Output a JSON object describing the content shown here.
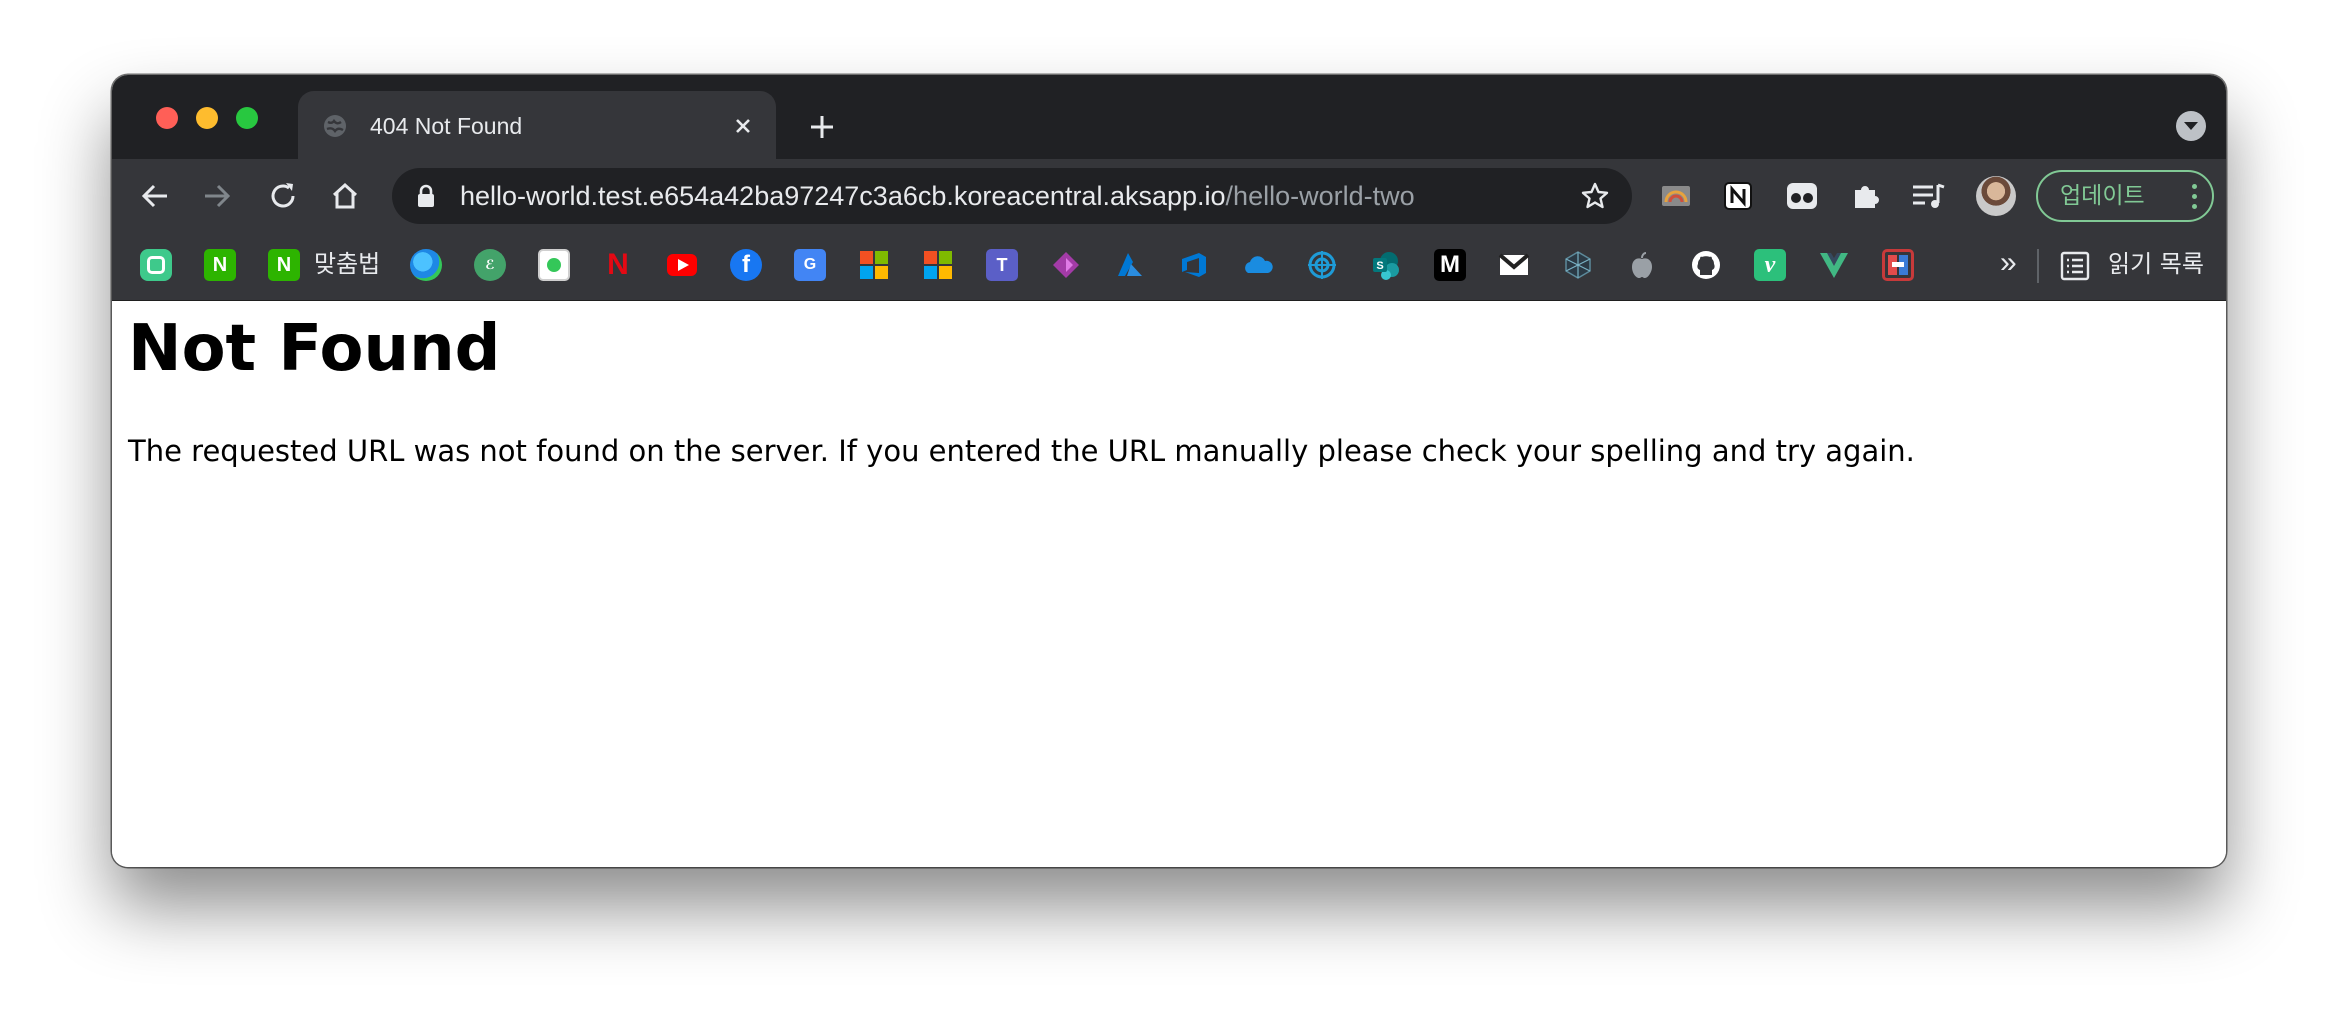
{
  "window": {
    "tab": {
      "title": "404 Not Found",
      "favicon": "globe-icon"
    },
    "toolbar": {
      "url_host": "hello-world.test.e654a42ba97247c3a6cb.koreacentral.aksapp.io",
      "url_path": "/hello-world-two",
      "update_label": "업데이트"
    },
    "bookmarks": {
      "labeled_item": "맞춤법",
      "overflow_label": "»",
      "reading_list_label": "읽기 목록",
      "icons": [
        "dooray-icon",
        "naver-icon",
        "naver-spellcheck-icon",
        "edge-icon",
        "papago-icon",
        "kakao-map-icon",
        "netflix-icon",
        "youtube-icon",
        "facebook-icon",
        "google-translate-icon",
        "microsoft-icon",
        "microsoft-icon-2",
        "teams-icon",
        "power-apps-icon",
        "azure-icon",
        "azure-devops-icon",
        "onedrive-icon",
        "web-target-icon",
        "sharepoint-icon",
        "medium-icon",
        "gmail-icon",
        "codesandbox-icon",
        "apple-icon",
        "github-icon",
        "vimeo-icon",
        "vue-icon",
        "hackerrank-icon"
      ]
    }
  },
  "page": {
    "heading": "Not Found",
    "message": "The requested URL was not found on the server. If you entered the URL manually please check your spelling and try again."
  },
  "colors": {
    "tabstrip": "#202124",
    "toolbar": "#35363a",
    "update_accent": "#81c995"
  }
}
